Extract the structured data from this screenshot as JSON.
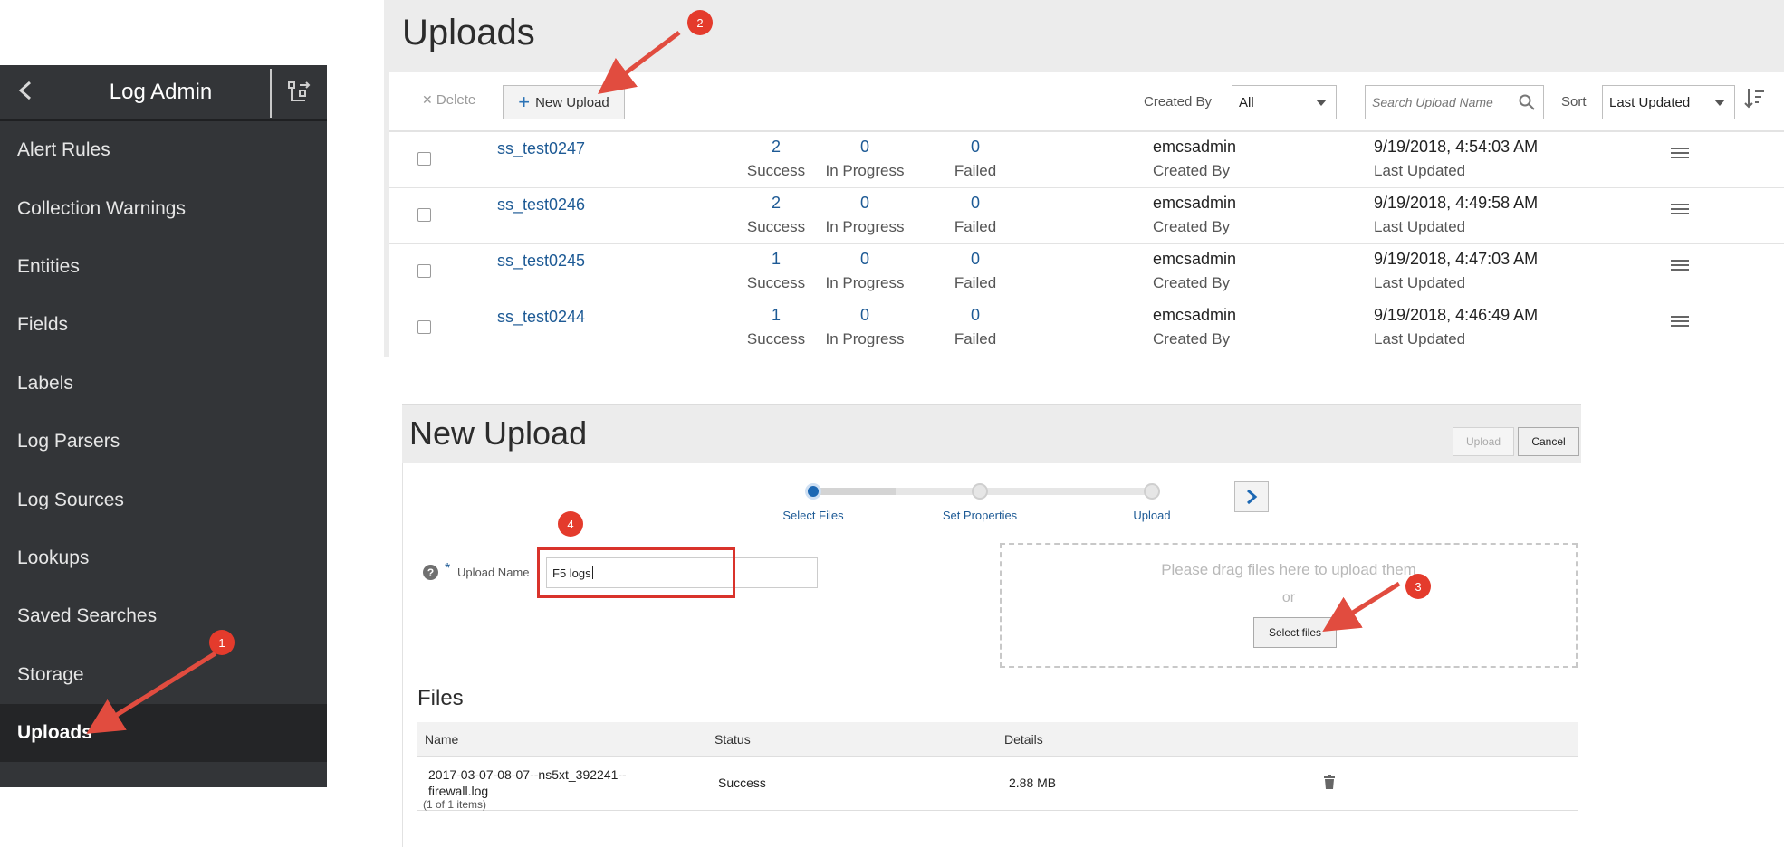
{
  "sidebar": {
    "title": "Log Admin",
    "back_icon": "chevron-left-icon",
    "toggle_icon": "panel-toggle-icon",
    "items": [
      {
        "label": "Alert Rules"
      },
      {
        "label": "Collection Warnings"
      },
      {
        "label": "Entities"
      },
      {
        "label": "Fields"
      },
      {
        "label": "Labels"
      },
      {
        "label": "Log Parsers"
      },
      {
        "label": "Log Sources"
      },
      {
        "label": "Lookups"
      },
      {
        "label": "Saved Searches"
      },
      {
        "label": "Storage"
      },
      {
        "label": "Uploads",
        "active": true
      }
    ]
  },
  "uploads": {
    "title": "Uploads",
    "toolbar": {
      "delete_label": "Delete",
      "new_upload_label": "New Upload",
      "created_by_label": "Created By",
      "created_by_value": "All",
      "search_placeholder": "Search Upload Name",
      "sort_label": "Sort",
      "sort_value": "Last Updated"
    },
    "rows": [
      {
        "name": "ss_test0247",
        "success": "2",
        "success_label": "Success",
        "in_progress": "0",
        "in_progress_label": "In Progress",
        "failed": "0",
        "failed_label": "Failed",
        "created_by": "emcsadmin",
        "created_by_label": "Created By",
        "updated": "9/19/2018, 4:54:03 AM",
        "updated_label": "Last Updated"
      },
      {
        "name": "ss_test0246",
        "success": "2",
        "success_label": "Success",
        "in_progress": "0",
        "in_progress_label": "In Progress",
        "failed": "0",
        "failed_label": "Failed",
        "created_by": "emcsadmin",
        "created_by_label": "Created By",
        "updated": "9/19/2018, 4:49:58 AM",
        "updated_label": "Last Updated"
      },
      {
        "name": "ss_test0245",
        "success": "1",
        "success_label": "Success",
        "in_progress": "0",
        "in_progress_label": "In Progress",
        "failed": "0",
        "failed_label": "Failed",
        "created_by": "emcsadmin",
        "created_by_label": "Created By",
        "updated": "9/19/2018, 4:47:03 AM",
        "updated_label": "Last Updated"
      },
      {
        "name": "ss_test0244",
        "success": "1",
        "success_label": "Success",
        "in_progress": "0",
        "in_progress_label": "In Progress",
        "failed": "0",
        "failed_label": "Failed",
        "created_by": "emcsadmin",
        "created_by_label": "Created By",
        "updated": "9/19/2018, 4:46:49 AM",
        "updated_label": "Last Updated"
      }
    ]
  },
  "new_upload": {
    "title": "New Upload",
    "upload_button": "Upload",
    "cancel_button": "Cancel",
    "steps": [
      "Select Files",
      "Set Properties",
      "Upload"
    ],
    "active_step": 0,
    "field_label": "Upload Name",
    "field_required_mark": "*",
    "field_value": "F5 logs",
    "help_glyph": "?",
    "dropzone_text": "Please drag files here to upload them",
    "dropzone_or": "or",
    "select_files_button": "Select files",
    "files_title": "Files",
    "files_columns": [
      "Name",
      "Status",
      "Details"
    ],
    "files": [
      {
        "name_line1": "2017-03-07-08-07--ns5xt_392241--",
        "name_line2": "firewall.log",
        "status": "Success",
        "details": "2.88 MB"
      }
    ],
    "files_count": "(1 of 1 items)"
  },
  "annotations": {
    "badges": [
      "1",
      "2",
      "3",
      "4"
    ],
    "color": "#e43b2c"
  },
  "colors": {
    "sidebar_bg": "#333538",
    "link_blue": "#1d5a95",
    "accent_blue": "#1d68b3"
  }
}
